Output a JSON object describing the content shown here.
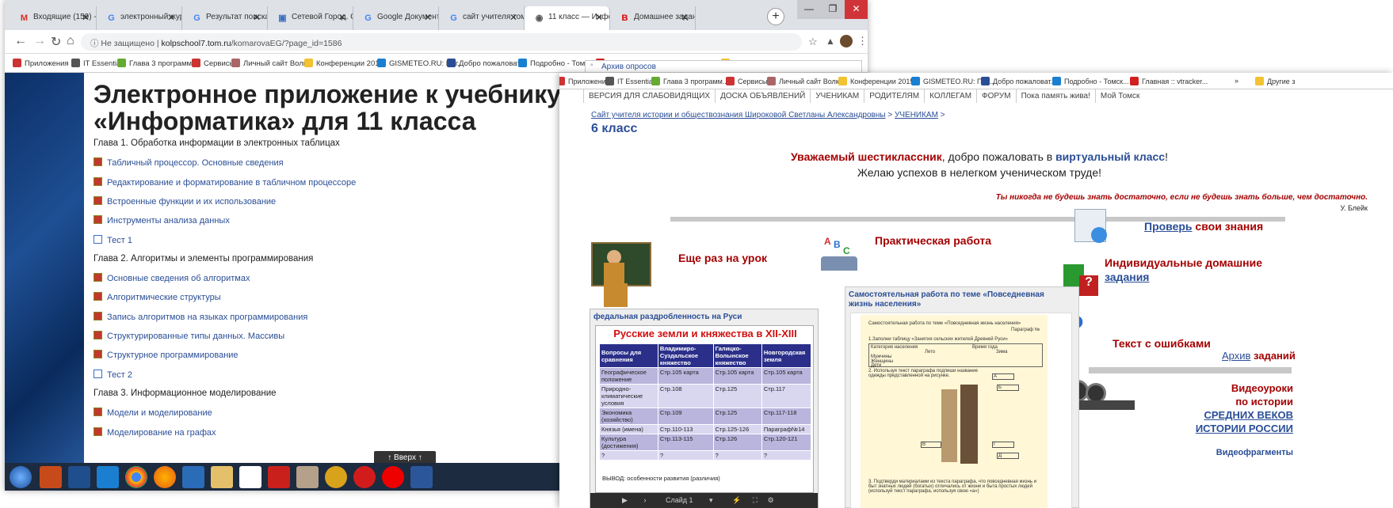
{
  "left_window": {
    "tabs": [
      {
        "label": "Входящие (159) - va",
        "icon": "gmail-icon",
        "color": "#d93025",
        "glyph": "M"
      },
      {
        "label": "электронный журн",
        "icon": "google-icon",
        "color": "#4285f4",
        "glyph": "G"
      },
      {
        "label": "Результат поиска G",
        "icon": "google-icon",
        "color": "#4285f4",
        "glyph": "G"
      },
      {
        "label": "Сетевой Город. Обр",
        "icon": "netcity-icon",
        "color": "#3a6fc4",
        "glyph": "▣"
      },
      {
        "label": "Google Документы",
        "icon": "google-icon",
        "color": "#4285f4",
        "glyph": "G"
      },
      {
        "label": "сайт учителя томск",
        "icon": "google-icon",
        "color": "#4285f4",
        "glyph": "G"
      },
      {
        "label": "11 класс — Инфор",
        "icon": "site-icon",
        "color": "#555",
        "glyph": "◉"
      },
      {
        "label": "Домашнее задание",
        "icon": "b-icon",
        "color": "#d00",
        "glyph": "B"
      }
    ],
    "url_prefix": "Не защищено",
    "url_host": "kolpschool7.tom.ru",
    "url_path": "/komarovaEG/?page_id=1586",
    "bookmarks": [
      "Приложения",
      "IT Essentials",
      "Глава 3 программ...",
      "Сервисы",
      "Личный сайт Волк...",
      "Конференции 2015",
      "GISMETEO.RU: Пог...",
      "Добро пожаловат...",
      "Подробно - Томск...",
      "Главная :: vtracker...",
      "Другие закладки"
    ],
    "bookmarks_more": "»",
    "page": {
      "title": "Электронное приложение к учебнику «Информатика» для 11 класса",
      "items": [
        {
          "kind": "chapter",
          "text": "Глава 1. Обработка информации в электронных таблицах"
        },
        {
          "kind": "link",
          "text": "Табличный процессор. Основные сведения"
        },
        {
          "kind": "link",
          "text": "Редактирование и форматирование в табличном процессоре"
        },
        {
          "kind": "link",
          "text": "Встроенные функции и их использование"
        },
        {
          "kind": "link",
          "text": "Инструменты анализа данных"
        },
        {
          "kind": "test",
          "text": "Тест 1"
        },
        {
          "kind": "chapter",
          "text": "Глава 2. Алгоритмы и элементы программирования"
        },
        {
          "kind": "link",
          "text": "Основные сведения об алгоритмах"
        },
        {
          "kind": "link",
          "text": "Алгоритмические структуры"
        },
        {
          "kind": "link",
          "text": "Запись алгоритмов на языках программирования"
        },
        {
          "kind": "link",
          "text": "Структурированные типы данных. Массивы"
        },
        {
          "kind": "link",
          "text": "Структурное программирование"
        },
        {
          "kind": "test",
          "text": "Тест 2"
        },
        {
          "kind": "chapter",
          "text": "Глава 3. Информационное моделирование"
        },
        {
          "kind": "link",
          "text": "Модели и моделирование"
        },
        {
          "kind": "link",
          "text": "Моделирование на графах"
        }
      ],
      "back_to_top": "↑ Вверх ↑"
    }
  },
  "right_window": {
    "bookmarks": [
      "Приложения",
      "IT Essentials",
      "Глава 3 программ...",
      "Сервисы",
      "Личный сайт Волк...",
      "Конференции 2015",
      "GISMETEO.RU: Пог...",
      "Добро пожаловат...",
      "Подробно - Томск...",
      "Главная :: vtracker...",
      "Другие з"
    ],
    "bookmarks_more": "»",
    "dropdown_item": "Архив опросов",
    "menu": [
      "ВЕРСИЯ ДЛЯ СЛАБОВИДЯЩИХ",
      "ДОСКА ОБЪЯВЛЕНИЙ",
      "УЧЕНИКАМ",
      "РОДИТЕЛЯМ",
      "КОЛЛЕГАМ",
      "ФОРУМ",
      "Пока память жива!",
      "Мой Томск"
    ],
    "breadcrumb": {
      "site": "Сайт учителя истории и обществознания Широковой Светланы Александровны",
      "sep1": " > ",
      "section": "УЧЕНИКАМ",
      "sep2": " >"
    },
    "page_title": "6 класс",
    "welcome1a": "Уважаемый шестиклассник",
    "welcome1b": ", добро пожаловать в ",
    "welcome1c": "виртуальный класс",
    "welcome1d": "!",
    "welcome2": "Желаю успехов в нелегком ученическом труде!",
    "quote": "Ты никогда не будешь знать достаточно, если не будешь знать больше, чем достаточно.",
    "quote_author": "У. Блейк",
    "blocks": {
      "lesson": "Еще раз на урок",
      "practice": "Практическая работа",
      "check_link": "Проверь",
      "check_rest": " свои знания",
      "hw_title": "Индивидуальные домашние",
      "hw_link": "задания",
      "errors": "Текст с ошибками",
      "archive_link": "Архив",
      "archive_rest": " заданий",
      "video1": "Видеоуроки",
      "video2": "по истории",
      "video3": "СРЕДНИХ ВЕКОВ",
      "video4": "ИСТОРИИ РОССИИ",
      "video5": "Видеофрагменты"
    },
    "slide": {
      "embed_title": "федальная раздробленность на Руси",
      "heading": "Русские земли и княжества в XII-XIII веках",
      "headers": [
        "Вопросы для сравнения",
        "Владимиро-Суздальское княжество",
        "Галицко-Волынское княжество",
        "Новгородская земля"
      ],
      "rows": [
        [
          "Географическое положение",
          "Стр.105 карта",
          "Стр.105 карта",
          "Стр.105 карта"
        ],
        [
          "Природно-климатические условия",
          "Стр.108",
          "Стр.125",
          "Стр.117"
        ],
        [
          "Экономика (хозяйство)",
          "Стр.109",
          "Стр.125",
          "Стр.117-118"
        ],
        [
          "Князья (имена)",
          "Стр.110-113",
          "Стр.125-126",
          "Параграф№14"
        ],
        [
          "Культура (достижения)",
          "Стр.113-115",
          "Стр.126",
          "Стр.120-121"
        ],
        [
          "?",
          "?",
          "?",
          "?"
        ]
      ],
      "conclusion": "ВЫВОД: особенности развития (различия)",
      "slide_label": "Слайд 1"
    },
    "doc": {
      "embed_title": "Самостоятельная работа по теме «Повседневная жизнь населения»",
      "line1": "Самостоятельная работа по теме «Повседневная жизнь населения»",
      "paragraph": "Параграф №",
      "task1": "1.Заполни таблицу «Занятия сельских жителей Древней Руси»",
      "col1": "Категория населения",
      "col2": "Время года",
      "sub1": "Лето",
      "sub2": "Зима",
      "r1": "Мужчины",
      "r2": "Женщины",
      "r3": "Дети",
      "task2": "2. Используя текст параграфа подпиши название одежды представленной на рисунке.",
      "task3": "3. Подтверди материалами из текста параграфа, что повседневная жизнь и быт знатных людей (богатых) отличались от жизни и быта простых людей (используй текст параграфа, используя свою «а»)",
      "box_letters": [
        "А",
        "Б",
        "В",
        "Г",
        "Д"
      ]
    }
  }
}
